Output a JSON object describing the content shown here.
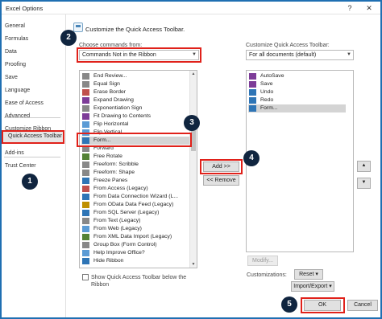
{
  "window": {
    "title": "Excel Options",
    "help_glyph": "?",
    "close_glyph": "✕"
  },
  "sidebar": {
    "items": [
      {
        "label": "General"
      },
      {
        "label": "Formulas"
      },
      {
        "label": "Data"
      },
      {
        "label": "Proofing"
      },
      {
        "label": "Save"
      },
      {
        "label": "Language"
      },
      {
        "label": "Ease of Access"
      },
      {
        "label": "Advanced"
      },
      {
        "label": "Customize Ribbon"
      },
      {
        "label": "Quick Access Toolbar",
        "selected": true
      },
      {
        "label": "Add-ins"
      },
      {
        "label": "Trust Center"
      }
    ]
  },
  "main": {
    "heading": "Customize the Quick Access Toolbar.",
    "choose_label": "Choose commands from:",
    "choose_value": "Commands Not in the Ribbon",
    "customize_label": "Customize Quick Access Toolbar:",
    "customize_value": "For all documents (default)",
    "commands": [
      {
        "label": "End Review...",
        "icon": "ic-e"
      },
      {
        "label": "Equal Sign",
        "icon": "ic-e"
      },
      {
        "label": "Erase Border",
        "icon": "ic-c"
      },
      {
        "label": "Expand Drawing",
        "icon": "ic-a"
      },
      {
        "label": "Exponentiation Sign",
        "icon": "ic-e"
      },
      {
        "label": "Fit Drawing to Contents",
        "icon": "ic-a"
      },
      {
        "label": "Flip Horizontal",
        "icon": "ic-g"
      },
      {
        "label": "Flip Vertical",
        "icon": "ic-g"
      },
      {
        "label": "Form...",
        "icon": "ic-b",
        "selected": true
      },
      {
        "label": "Forward",
        "icon": "ic-e"
      },
      {
        "label": "Free Rotate",
        "icon": "ic-d"
      },
      {
        "label": "Freeform: Scribble",
        "icon": "ic-e"
      },
      {
        "label": "Freeform: Shape",
        "icon": "ic-e"
      },
      {
        "label": "Freeze Panes",
        "icon": "ic-b"
      },
      {
        "label": "From Access (Legacy)",
        "icon": "ic-c"
      },
      {
        "label": "From Data Connection Wizard (L...",
        "icon": "ic-b"
      },
      {
        "label": "From OData Data Feed (Legacy)",
        "icon": "ic-f"
      },
      {
        "label": "From SQL Server (Legacy)",
        "icon": "ic-b"
      },
      {
        "label": "From Text (Legacy)",
        "icon": "ic-e"
      },
      {
        "label": "From Web (Legacy)",
        "icon": "ic-g"
      },
      {
        "label": "From XML Data Import (Legacy)",
        "icon": "ic-d"
      },
      {
        "label": "Group Box (Form Control)",
        "icon": "ic-e"
      },
      {
        "label": "Help Improve Office?",
        "icon": "ic-g"
      },
      {
        "label": "Hide Ribbon",
        "icon": "ic-b"
      }
    ],
    "toolbar_items": [
      {
        "label": "AutoSave",
        "icon": "ic-a"
      },
      {
        "label": "Save",
        "icon": "ic-a"
      },
      {
        "label": "Undo",
        "icon": "ic-b"
      },
      {
        "label": "Redo",
        "icon": "ic-b"
      },
      {
        "label": "Form...",
        "icon": "ic-b",
        "selected": true
      }
    ],
    "add_button": "Add >>",
    "remove_button": "<< Remove",
    "modify_button": "Modify...",
    "show_below_label": "Show Quick Access Toolbar below the Ribbon",
    "customizations_label": "Customizations:",
    "reset_button": "Reset ▾",
    "import_export_button": "Import/Export ▾",
    "ok_button": "OK",
    "cancel_button": "Cancel"
  },
  "badges": [
    "1",
    "2",
    "3",
    "4",
    "5"
  ],
  "colors": {
    "highlight_red": "#e0211a",
    "badge_navy": "#10253f",
    "frame_blue": "#1f6fb2"
  }
}
